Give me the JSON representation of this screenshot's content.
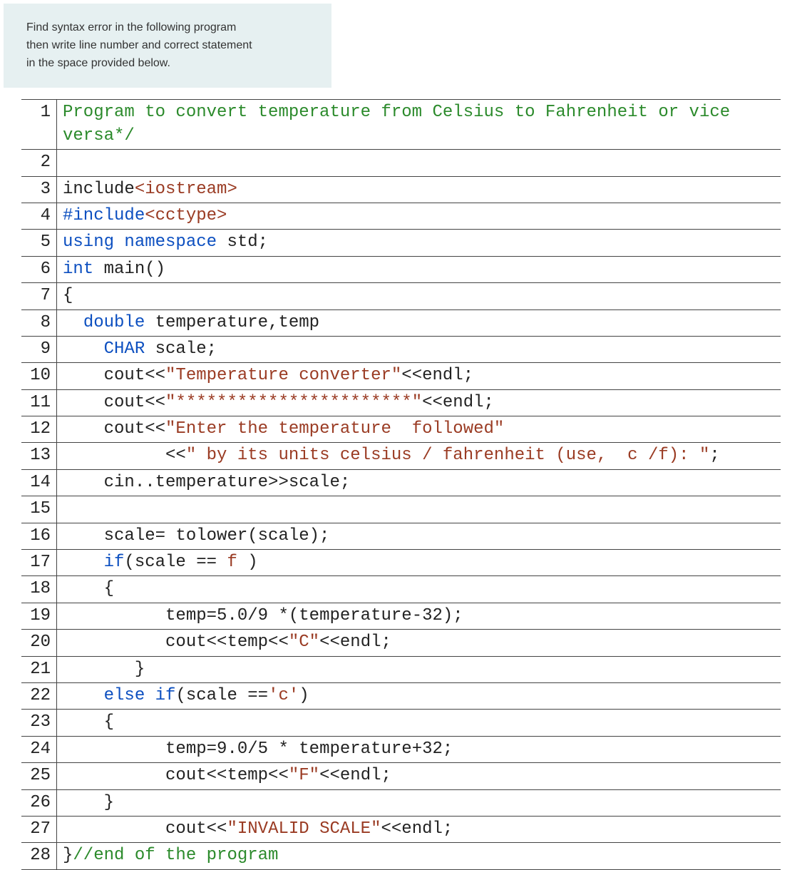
{
  "prompt": {
    "line1": "Find syntax error in the following program",
    "line2": "then write line number and correct statement",
    "line3": "in the space provided below."
  },
  "lines": [
    {
      "n": "1",
      "tokens": [
        {
          "t": "Program to convert temperature from Celsius to Fahrenheit or vice versa*/",
          "c": "tok-comment"
        }
      ]
    },
    {
      "n": "2",
      "tokens": [
        {
          "t": "",
          "c": ""
        }
      ]
    },
    {
      "n": "3",
      "tokens": [
        {
          "t": "include",
          "c": ""
        },
        {
          "t": "<iostream>",
          "c": "tok-inc"
        }
      ]
    },
    {
      "n": "4",
      "tokens": [
        {
          "t": "#include",
          "c": "tok-kw"
        },
        {
          "t": "<cctype>",
          "c": "tok-inc"
        }
      ]
    },
    {
      "n": "5",
      "tokens": [
        {
          "t": "using",
          "c": "tok-kw"
        },
        {
          "t": " ",
          "c": ""
        },
        {
          "t": "namespace",
          "c": "tok-kw"
        },
        {
          "t": " std;",
          "c": ""
        }
      ]
    },
    {
      "n": "6",
      "tokens": [
        {
          "t": "int",
          "c": "tok-kw"
        },
        {
          "t": " main()",
          "c": ""
        }
      ]
    },
    {
      "n": "7",
      "tokens": [
        {
          "t": "{",
          "c": ""
        }
      ]
    },
    {
      "n": "8",
      "tokens": [
        {
          "t": "  ",
          "c": ""
        },
        {
          "t": "double",
          "c": "tok-kw"
        },
        {
          "t": " temperature,temp",
          "c": ""
        }
      ]
    },
    {
      "n": "9",
      "tokens": [
        {
          "t": "    ",
          "c": ""
        },
        {
          "t": "CHAR",
          "c": "tok-kw"
        },
        {
          "t": " scale;",
          "c": ""
        }
      ]
    },
    {
      "n": "10",
      "tokens": [
        {
          "t": "    cout<<",
          "c": ""
        },
        {
          "t": "\"Temperature converter\"",
          "c": "tok-str"
        },
        {
          "t": "<<endl;",
          "c": ""
        }
      ]
    },
    {
      "n": "11",
      "tokens": [
        {
          "t": "    cout<<",
          "c": ""
        },
        {
          "t": "\"***********************\"",
          "c": "tok-str"
        },
        {
          "t": "<<endl;",
          "c": ""
        }
      ]
    },
    {
      "n": "12",
      "tokens": [
        {
          "t": "    cout<<",
          "c": ""
        },
        {
          "t": "\"Enter the temperature  followed\"",
          "c": "tok-str"
        }
      ]
    },
    {
      "n": "13",
      "tokens": [
        {
          "t": "          <<",
          "c": ""
        },
        {
          "t": "\" by its units celsius / fahrenheit (use,  c /f): \"",
          "c": "tok-str"
        },
        {
          "t": ";",
          "c": ""
        }
      ]
    },
    {
      "n": "14",
      "tokens": [
        {
          "t": "    cin..temperature>>scale;",
          "c": ""
        }
      ]
    },
    {
      "n": "15",
      "tokens": [
        {
          "t": "",
          "c": ""
        }
      ]
    },
    {
      "n": "16",
      "tokens": [
        {
          "t": "    scale= tolower(scale);",
          "c": ""
        }
      ]
    },
    {
      "n": "17",
      "tokens": [
        {
          "t": "    ",
          "c": ""
        },
        {
          "t": "if",
          "c": "tok-kw"
        },
        {
          "t": "(scale == ",
          "c": ""
        },
        {
          "t": "f",
          "c": "tok-str"
        },
        {
          "t": " )",
          "c": ""
        }
      ]
    },
    {
      "n": "18",
      "tokens": [
        {
          "t": "    {",
          "c": ""
        }
      ]
    },
    {
      "n": "19",
      "tokens": [
        {
          "t": "          temp=5.0/9 *(temperature-32);",
          "c": ""
        }
      ]
    },
    {
      "n": "20",
      "tokens": [
        {
          "t": "          cout<<temp<<",
          "c": ""
        },
        {
          "t": "\"C\"",
          "c": "tok-str"
        },
        {
          "t": "<<endl;",
          "c": ""
        }
      ]
    },
    {
      "n": "21",
      "tokens": [
        {
          "t": "       }",
          "c": ""
        }
      ]
    },
    {
      "n": "22",
      "tokens": [
        {
          "t": "    ",
          "c": ""
        },
        {
          "t": "else",
          "c": "tok-kw"
        },
        {
          "t": " ",
          "c": ""
        },
        {
          "t": "if",
          "c": "tok-kw"
        },
        {
          "t": "(scale ==",
          "c": ""
        },
        {
          "t": "'c'",
          "c": "tok-str"
        },
        {
          "t": ")",
          "c": ""
        }
      ]
    },
    {
      "n": "23",
      "tokens": [
        {
          "t": "    {",
          "c": ""
        }
      ]
    },
    {
      "n": "24",
      "tokens": [
        {
          "t": "          temp=9.0/5 * temperature+32;",
          "c": ""
        }
      ]
    },
    {
      "n": "25",
      "tokens": [
        {
          "t": "          cout<<temp<<",
          "c": ""
        },
        {
          "t": "\"F\"",
          "c": "tok-str"
        },
        {
          "t": "<<endl;",
          "c": ""
        }
      ]
    },
    {
      "n": "26",
      "tokens": [
        {
          "t": "    }",
          "c": ""
        }
      ]
    },
    {
      "n": "27",
      "tokens": [
        {
          "t": "          cout<<",
          "c": ""
        },
        {
          "t": "\"INVALID SCALE\"",
          "c": "tok-str"
        },
        {
          "t": "<<endl;",
          "c": ""
        }
      ]
    },
    {
      "n": "28",
      "tokens": [
        {
          "t": "}",
          "c": ""
        },
        {
          "t": "//end of the program",
          "c": "tok-comment"
        }
      ]
    }
  ]
}
